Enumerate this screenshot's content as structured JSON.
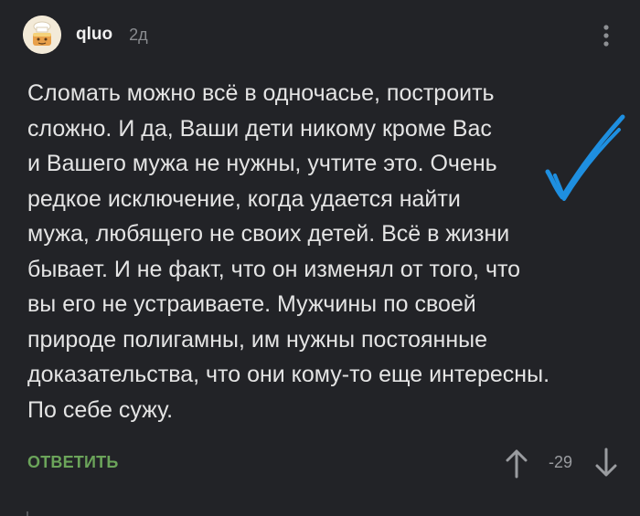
{
  "comment": {
    "author": "qluo",
    "time": "2д",
    "lines": [
      "Сломать можно всё в одночасье, построить",
      "сложно. И да, Ваши дети никому кроме Вас",
      "и Вашего мужа не нужны, учтите это. Очень",
      "редкое исключение, когда удается найти",
      "мужа, любящего не своих детей. Всё в жизни",
      "бывает. И не факт, что он изменял от того, что",
      "вы его не устраиваете. Мужчины по своей",
      "природе полигамны, им нужны постоянные",
      "доказательства, что они кому-то еще интересны.",
      "По себе сужу."
    ]
  },
  "actions": {
    "reply_label": "ОТВЕТИТЬ",
    "rating": "-29"
  },
  "icons": {
    "more": "more-vertical-icon",
    "upvote": "arrow-up-icon",
    "downvote": "arrow-down-icon",
    "annotation": "checkmark-annotation"
  },
  "colors": {
    "background": "#222327",
    "text": "#e4e4e4",
    "reply": "#6ba45a",
    "muted": "#8a8c90",
    "annotation": "#1e8fe0"
  }
}
